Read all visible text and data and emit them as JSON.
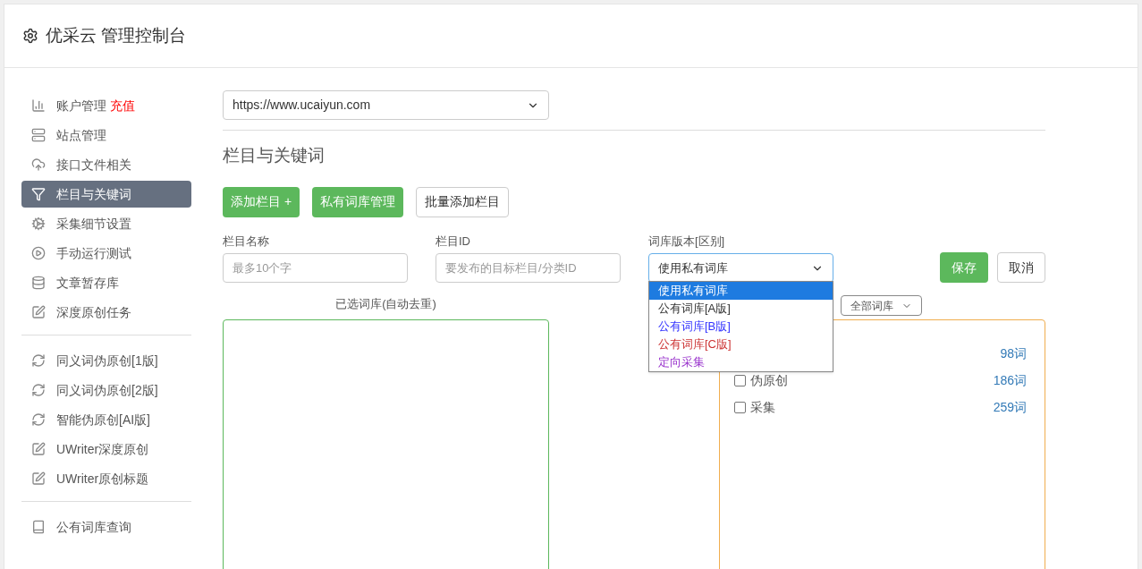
{
  "header": {
    "title": "优采云 管理控制台"
  },
  "sidebar": {
    "groups": [
      {
        "items": [
          {
            "label": "账户管理",
            "badge": "充值",
            "selected": false
          },
          {
            "label": "站点管理",
            "selected": false
          },
          {
            "label": "接口文件相关",
            "selected": false
          },
          {
            "label": "栏目与关键词",
            "selected": true
          },
          {
            "label": "采集细节设置",
            "selected": false
          },
          {
            "label": "手动运行测试",
            "selected": false
          },
          {
            "label": "文章暂存库",
            "selected": false
          },
          {
            "label": "深度原创任务",
            "selected": false
          }
        ]
      },
      {
        "items": [
          {
            "label": "同义词伪原创[1版]",
            "selected": false
          },
          {
            "label": "同义词伪原创[2版]",
            "selected": false
          },
          {
            "label": "智能伪原创[AI版]",
            "selected": false
          },
          {
            "label": "UWriter深度原创",
            "selected": false
          },
          {
            "label": "UWriter原创标题",
            "selected": false
          }
        ]
      },
      {
        "items": [
          {
            "label": "公有词库查询",
            "selected": false
          }
        ]
      }
    ]
  },
  "site_select": {
    "value": "https://www.ucaiyun.com"
  },
  "section_title": "栏目与关键词",
  "buttons": [
    {
      "kind": "primary",
      "label": "添加栏目 +"
    },
    {
      "kind": "primary",
      "label": "私有词库管理"
    },
    {
      "kind": "default",
      "label": "批量添加栏目"
    }
  ],
  "form": {
    "name_field": {
      "label": "栏目名称",
      "placeholder": "最多10个字"
    },
    "id_field": {
      "label": "栏目ID",
      "placeholder": "要发布的目标栏目/分类ID"
    },
    "version_select": {
      "label": "词库版本[区别]",
      "value": "使用私有词库",
      "expanded": true,
      "options": [
        {
          "label": "使用私有词库",
          "selected": true
        },
        {
          "label": "公有词库[A版]",
          "selected": false,
          "color": "#333333"
        },
        {
          "label": "公有词库[B版]",
          "selected": false,
          "color": "#3333ff"
        },
        {
          "label": "公有词库[C版]",
          "selected": false,
          "color": "#cc3333"
        },
        {
          "label": "定向采集",
          "selected": false,
          "color": "#9933cc"
        }
      ]
    },
    "save": "保存",
    "cancel": "取消"
  },
  "selected_panel": {
    "title": "已选词库(自动去重)"
  },
  "library_panel": {
    "filter": "全部词库",
    "rows": [
      {
        "count": "98词"
      },
      {
        "label": "伪原创",
        "count": "186词",
        "checked": false
      },
      {
        "label": "采集",
        "count": "259词",
        "checked": false
      }
    ]
  }
}
